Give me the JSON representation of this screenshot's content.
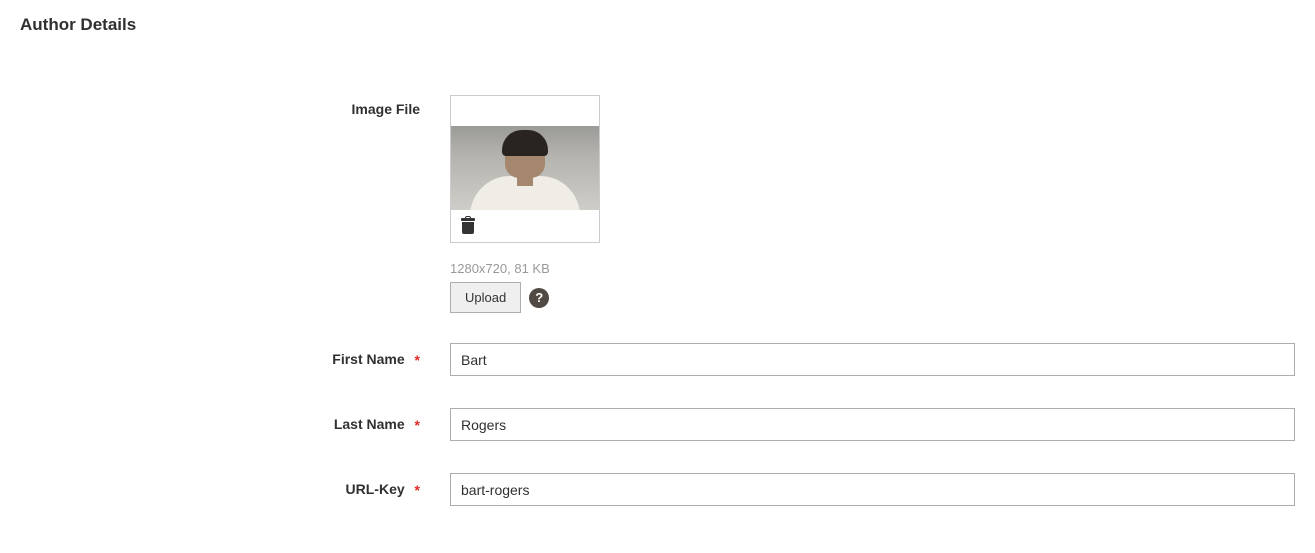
{
  "section": {
    "title": "Author Details"
  },
  "fields": {
    "image": {
      "label": "Image File",
      "meta": "1280x720, 81 KB",
      "upload_label": "Upload",
      "help_symbol": "?"
    },
    "first_name": {
      "label": "First Name",
      "value": "Bart"
    },
    "last_name": {
      "label": "Last Name",
      "value": "Rogers"
    },
    "url_key": {
      "label": "URL-Key",
      "value": "bart-rogers"
    }
  }
}
